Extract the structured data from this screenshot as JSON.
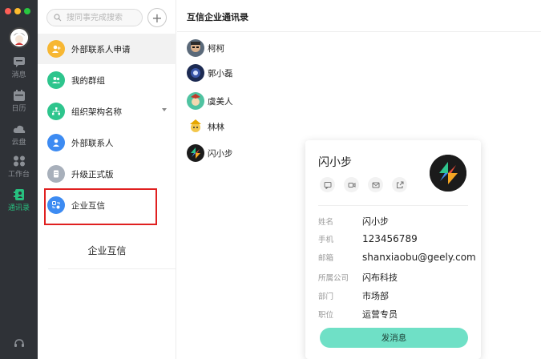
{
  "window": {
    "traffic_colors": [
      "#fe5f57",
      "#febc2e",
      "#28c840"
    ]
  },
  "rail": {
    "items": [
      {
        "label": "消息",
        "icon": "chat-icon"
      },
      {
        "label": "日历",
        "icon": "calendar-icon"
      },
      {
        "label": "云盘",
        "icon": "cloud-icon"
      },
      {
        "label": "工作台",
        "icon": "apps-icon"
      },
      {
        "label": "通讯录",
        "icon": "contacts-icon",
        "active": true
      }
    ],
    "accent": "#27c07f"
  },
  "search": {
    "placeholder": "搜同事完成搜索"
  },
  "sidebar": {
    "items": [
      {
        "label": "外部联系人申请",
        "icon": "add-contact-icon",
        "color": "#f7b733"
      },
      {
        "label": "我的群组",
        "icon": "group-icon",
        "color": "#2ec58d"
      },
      {
        "label": "组织架构名称",
        "icon": "org-icon",
        "color": "#2ec58d"
      },
      {
        "label": "外部联系人",
        "icon": "person-icon",
        "color": "#3d8bf2"
      },
      {
        "label": "升级正式版",
        "icon": "document-icon",
        "color": "#a8b0bb"
      },
      {
        "label": "企业互信",
        "icon": "trust-icon",
        "color": "#3d8bf2"
      }
    ],
    "bottom_label": "企业互信"
  },
  "main": {
    "title": "互信企业通讯录",
    "contacts": [
      {
        "name": "柯柯"
      },
      {
        "name": "郭小磊"
      },
      {
        "name": "虞美人"
      },
      {
        "name": "林林"
      },
      {
        "name": "闪小步"
      }
    ]
  },
  "card": {
    "name": "闪小步",
    "actions": [
      "message-icon",
      "video-icon",
      "mail-icon",
      "share-icon"
    ],
    "fields": [
      {
        "key": "姓名",
        "value": "闪小步"
      },
      {
        "key": "手机",
        "value": "123456789"
      },
      {
        "key": "邮箱",
        "value": "shanxiaobu@geely.com"
      },
      {
        "key": "所属公司",
        "value": "闪布科技"
      },
      {
        "key": "部门",
        "value": "市场部"
      },
      {
        "key": "职位",
        "value": "运营专员"
      }
    ],
    "send_label": "发消息",
    "button_color": "#6fe0c6"
  }
}
